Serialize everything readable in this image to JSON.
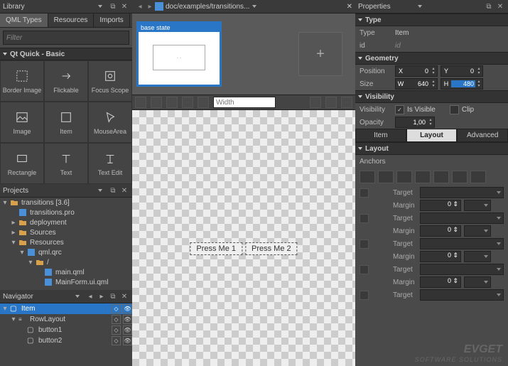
{
  "library": {
    "title": "Library",
    "tabs": [
      "QML Types",
      "Resources",
      "Imports"
    ],
    "active_tab": 0,
    "filter_placeholder": "Filter",
    "section": "Qt Quick - Basic",
    "types": [
      "Border Image",
      "Flickable",
      "Focus Scope",
      "Image",
      "Item",
      "MouseArea",
      "Rectangle",
      "Text",
      "Text Edit"
    ]
  },
  "projects": {
    "title": "Projects",
    "tree": [
      {
        "d": 0,
        "exp": "▾",
        "icon": "folder-open",
        "label": "transitions [3.6]"
      },
      {
        "d": 1,
        "exp": "",
        "icon": "pro",
        "label": "transitions.pro"
      },
      {
        "d": 1,
        "exp": "▸",
        "icon": "folder",
        "label": "deployment"
      },
      {
        "d": 1,
        "exp": "▸",
        "icon": "folder",
        "label": "Sources"
      },
      {
        "d": 1,
        "exp": "▾",
        "icon": "folder-open",
        "label": "Resources"
      },
      {
        "d": 2,
        "exp": "▾",
        "icon": "qrc",
        "label": "qml.qrc"
      },
      {
        "d": 3,
        "exp": "▾",
        "icon": "folder",
        "label": "/"
      },
      {
        "d": 4,
        "exp": "",
        "icon": "qml",
        "label": "main.qml"
      },
      {
        "d": 4,
        "exp": "",
        "icon": "qml",
        "label": "MainForm.ui.qml"
      }
    ]
  },
  "navigator": {
    "title": "Navigator",
    "tree": [
      {
        "d": 0,
        "exp": "▾",
        "icon": "item",
        "label": "Item",
        "sel": true
      },
      {
        "d": 1,
        "exp": "▾",
        "icon": "rowlayout",
        "label": "RowLayout"
      },
      {
        "d": 2,
        "exp": "",
        "icon": "button",
        "label": "button1"
      },
      {
        "d": 2,
        "exp": "",
        "icon": "button",
        "label": "button2"
      }
    ]
  },
  "center": {
    "doc_path": "doc/examples/transitions...",
    "base_state_label": "base state",
    "width_placeholder": "Width",
    "canvas_buttons": [
      "Press Me 1",
      "Press Me 2"
    ]
  },
  "props": {
    "title": "Properties",
    "sec_type": "Type",
    "type_label": "Type",
    "type_value": "Item",
    "id_label": "id",
    "id_placeholder": "id",
    "sec_geom": "Geometry",
    "position_label": "Position",
    "size_label": "Size",
    "pos_x": "0",
    "pos_y": "0",
    "size_w": "640",
    "size_h": "480",
    "axis_x": "X",
    "axis_y": "Y",
    "axis_w": "W",
    "axis_h": "H",
    "sec_vis": "Visibility",
    "visibility_label": "Visibility",
    "is_visible": "Is Visible",
    "clip": "Clip",
    "opacity_label": "Opacity",
    "opacity_value": "1,00",
    "subtabs": [
      "Item",
      "Layout",
      "Advanced"
    ],
    "subtab_active": 1,
    "sec_layout": "Layout",
    "anchors_label": "Anchors",
    "layout_rows": [
      {
        "k": "Target"
      },
      {
        "k": "Margin",
        "v": "0"
      },
      {
        "k": "Target"
      },
      {
        "k": "Margin",
        "v": "0"
      },
      {
        "k": "Target"
      },
      {
        "k": "Margin",
        "v": "0"
      },
      {
        "k": "Target"
      },
      {
        "k": "Margin",
        "v": "0"
      },
      {
        "k": "Target"
      }
    ]
  },
  "watermark": {
    "line1": "EVGET",
    "line2": "SOFTWARE SOLUTIONS"
  }
}
